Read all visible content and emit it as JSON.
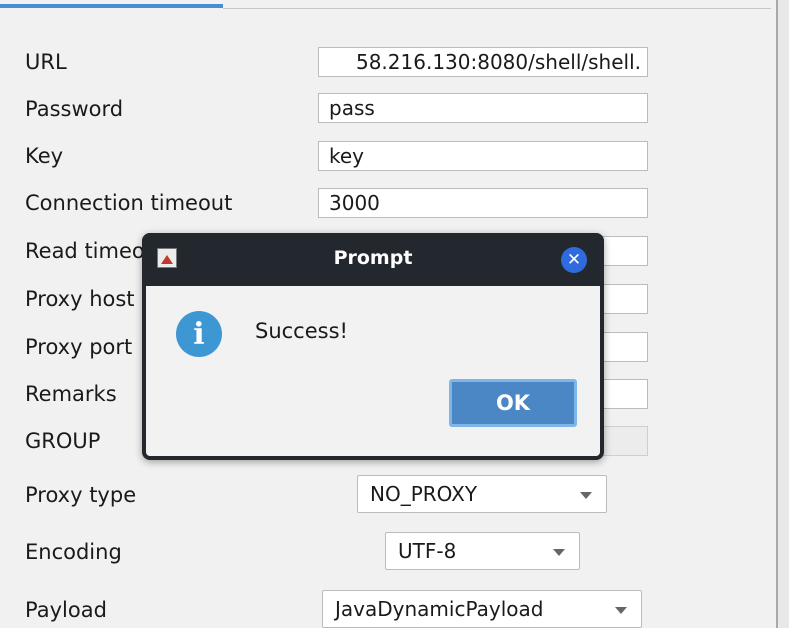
{
  "form": {
    "url": {
      "label": "URL",
      "value": "58.216.130:8080/shell/shell."
    },
    "password": {
      "label": "Password",
      "value": "pass"
    },
    "key": {
      "label": "Key",
      "value": "key"
    },
    "connection_timeout": {
      "label": "Connection timeout",
      "value": "3000"
    },
    "read_timeout": {
      "label": "Read timeout",
      "value": ""
    },
    "proxy_host": {
      "label": "Proxy host",
      "value": ""
    },
    "proxy_port": {
      "label": "Proxy port",
      "value": ""
    },
    "remarks": {
      "label": "Remarks",
      "value": ""
    },
    "group": {
      "label": "GROUP",
      "value": ""
    },
    "proxy_type": {
      "label": "Proxy type",
      "value": "NO_PROXY"
    },
    "encoding": {
      "label": "Encoding",
      "value": "UTF-8"
    },
    "payload": {
      "label": "Payload",
      "value": "JavaDynamicPayload"
    }
  },
  "dialog": {
    "title": "Prompt",
    "message": "Success!",
    "ok_label": "OK",
    "close_glyph": "✕",
    "info_glyph": "i",
    "icon": "info-icon"
  },
  "colors": {
    "accent": "#4a8bd6",
    "dialog_titlebar": "#23272e",
    "ok_button": "#4b86c5",
    "info": "#3d97d3",
    "close": "#2f6bdc"
  }
}
